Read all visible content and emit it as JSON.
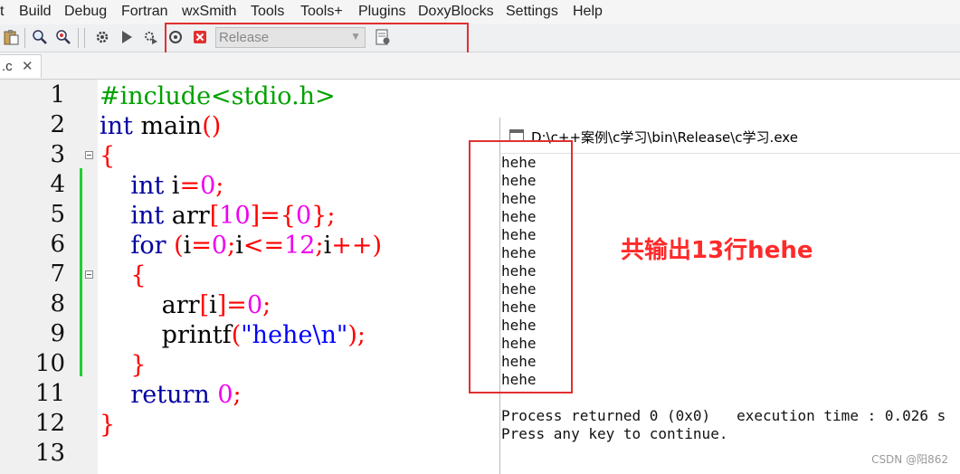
{
  "menubar": {
    "items": [
      "t",
      "Build",
      "Debug",
      "Fortran",
      "wxSmith",
      "Tools",
      "Tools+",
      "Plugins",
      "DoxyBlocks",
      "Settings",
      "Help"
    ]
  },
  "toolbar": {
    "icons": [
      "paste-icon",
      "find-icon",
      "find-replace-icon",
      "build-icon",
      "run-icon",
      "build-run-icon",
      "rebuild-icon",
      "abort-icon",
      "build-options-icon"
    ],
    "build_target": "Release"
  },
  "tabs": [
    {
      "label": ".c",
      "close": "✕"
    }
  ],
  "editor": {
    "line_numbers": [
      "1",
      "2",
      "3",
      "4",
      "5",
      "6",
      "7",
      "8",
      "9",
      "10",
      "11",
      "12",
      "13"
    ]
  },
  "console": {
    "title": "D:\\c++案例\\c学习\\bin\\Release\\c学习.exe",
    "output_lines": [
      "hehe",
      "hehe",
      "hehe",
      "hehe",
      "hehe",
      "hehe",
      "hehe",
      "hehe",
      "hehe",
      "hehe",
      "hehe",
      "hehe",
      "hehe"
    ],
    "process_line": "Process returned 0 (0x0)   execution time : 0.026 s",
    "continue_line": "Press any key to continue."
  },
  "annotation": "共输出13行hehe",
  "watermark": "CSDN @阳862",
  "colors": {
    "highlight": "#e03030",
    "annotation": "#ff2a2a",
    "keyword": "#0000a0",
    "preprocessor": "#00a000",
    "number": "#f000f0",
    "operator": "#ff0000",
    "string": "#0000ff"
  }
}
